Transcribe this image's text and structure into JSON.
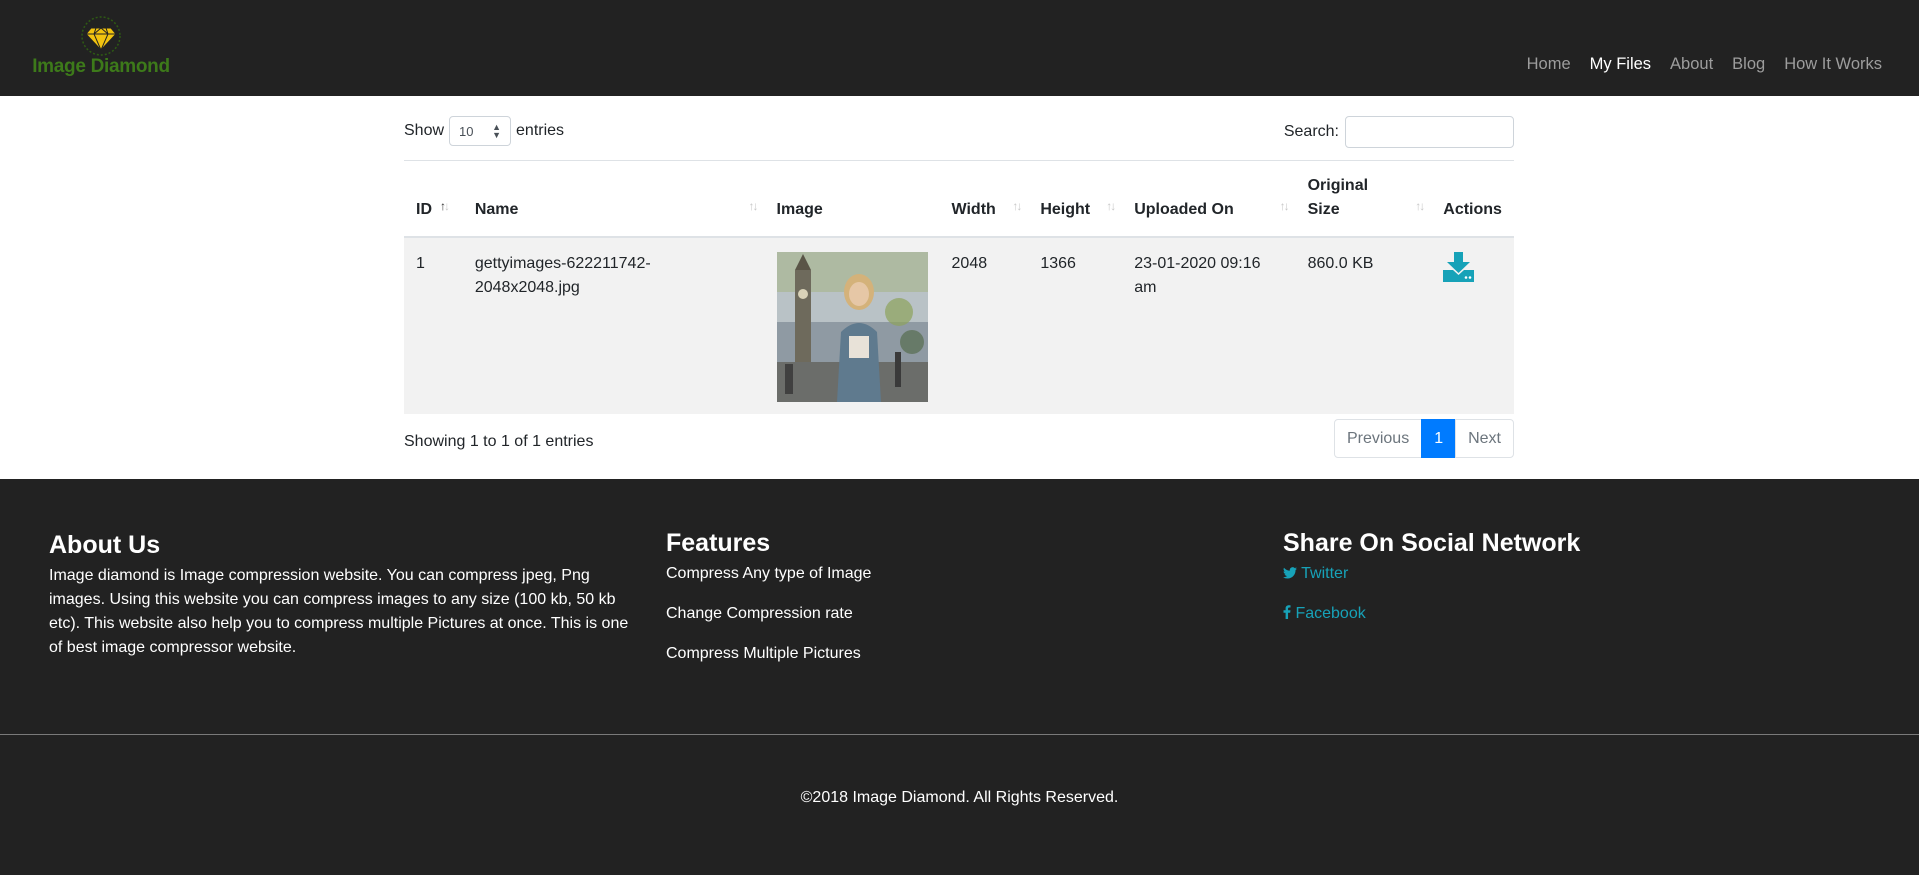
{
  "brand": {
    "name": "Image Diamond",
    "logo_color": "#3d7a1a",
    "gem_color": "#f2c30f"
  },
  "nav": {
    "items": [
      {
        "label": "Home",
        "active": false
      },
      {
        "label": "My Files",
        "active": true
      },
      {
        "label": "About",
        "active": false
      },
      {
        "label": "Blog",
        "active": false
      },
      {
        "label": "How It Works",
        "active": false
      }
    ]
  },
  "table_controls": {
    "show_label": "Show",
    "entries_label": "entries",
    "page_length": "10",
    "search_label": "Search:",
    "search_value": ""
  },
  "table": {
    "headers": [
      "ID",
      "Name",
      "Image",
      "Width",
      "Height",
      "Uploaded On",
      "Original Size",
      "Actions"
    ],
    "rows": [
      {
        "id": "1",
        "name": "gettyimages-622211742-2048x2048.jpg",
        "image_icon": "photo-thumbnail",
        "width": "2048",
        "height": "1366",
        "uploaded_on": "23-01-2020 09:16 am",
        "original_size": "860.0 KB",
        "action_icon": "download-icon"
      }
    ]
  },
  "table_footer": {
    "info": "Showing 1 to 1 of 1 entries",
    "previous": "Previous",
    "current_page": "1",
    "next": "Next"
  },
  "footer": {
    "about": {
      "title": "About Us",
      "text": "Image diamond is Image compression website. You can compress jpeg, Png images. Using this website you can compress images to any size (100 kb, 50 kb etc). This website also help you to compress multiple Pictures at once. This is one of best image compressor website."
    },
    "features": {
      "title": "Features",
      "items": [
        "Compress Any type of Image",
        "Change Compression rate",
        "Compress Multiple Pictures"
      ]
    },
    "social": {
      "title": "Share On Social Network",
      "links": [
        {
          "icon": "twitter-icon",
          "label": "Twitter"
        },
        {
          "icon": "facebook-icon",
          "label": "Facebook"
        }
      ]
    },
    "copyright": "©2018 Image Diamond. All Rights Reserved."
  },
  "colors": {
    "dark_bg": "#222222",
    "accent": "#007bff",
    "link": "#17a2b8",
    "row_bg": "#f2f2f2"
  }
}
